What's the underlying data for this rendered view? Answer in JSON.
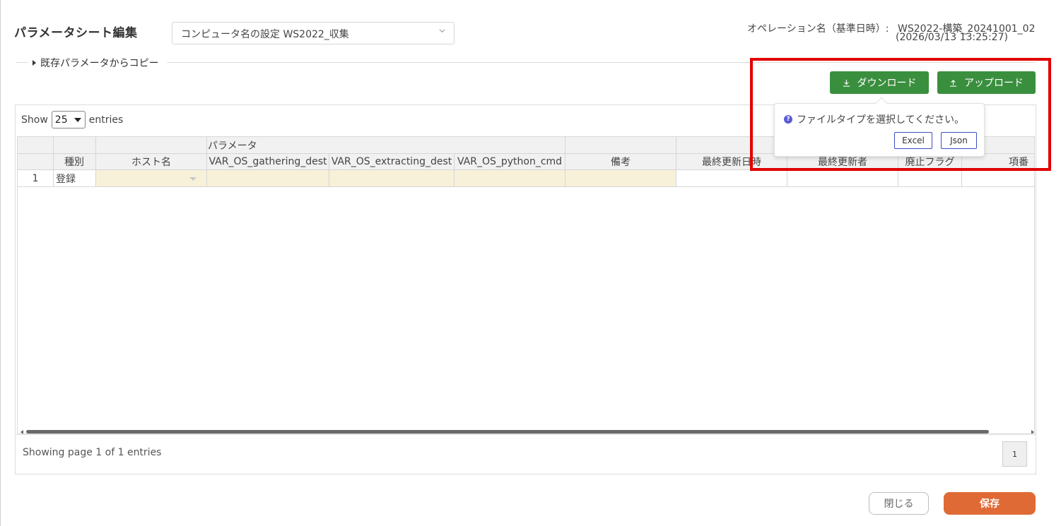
{
  "header": {
    "title": "パラメータシート編集",
    "sheet_select_value": "コンピュータ名の設定 WS2022_収集",
    "operation_label": "オペレーション名（基準日時）:",
    "operation_name": "WS2022-構築_20241001_02",
    "operation_date": "(2026/03/13 13:25:27)"
  },
  "copy_section": {
    "label": "既存パラメータからコピー"
  },
  "toolbar": {
    "download_label": "ダウンロード",
    "upload_label": "アップロード"
  },
  "popover": {
    "message": "ファイルタイプを選択してください。",
    "excel_label": "Excel",
    "json_label": "Json"
  },
  "table": {
    "show_label": "Show",
    "entries_value": "25",
    "entries_label": "entries",
    "group_header": "パラメータ",
    "columns": [
      "種別",
      "ホスト名",
      "VAR_OS_gathering_dest",
      "VAR_OS_extracting_dest",
      "VAR_OS_python_cmd",
      "備考",
      "最終更新日時",
      "最終更新者",
      "廃止フラグ",
      "項番"
    ],
    "rows": [
      {
        "num": "1",
        "type": "登録",
        "host": "",
        "gathering": "",
        "extracting": "",
        "python": "",
        "note": "",
        "updated_at": "",
        "updated_by": "",
        "discard": "",
        "item_no": ""
      }
    ],
    "footer_text": "Showing page 1 of 1 entries",
    "page_number": "1"
  },
  "actions": {
    "close_label": "閉じる",
    "save_label": "保存"
  },
  "colors": {
    "green": "#3a8f3e",
    "save": "#e06a35",
    "highlight": "#e00000",
    "editable": "#f7f1d9"
  }
}
